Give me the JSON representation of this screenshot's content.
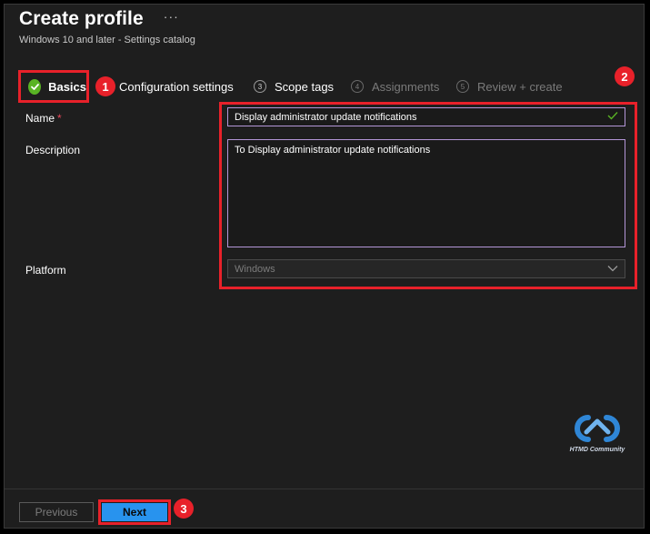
{
  "header": {
    "title": "Create profile",
    "more": "···",
    "subtitle": "Windows 10 and later - Settings catalog"
  },
  "steps": [
    {
      "num": "",
      "label": "Basics",
      "state": "complete"
    },
    {
      "num": "",
      "label": "Configuration settings",
      "state": "next"
    },
    {
      "num": "3",
      "label": "Scope tags",
      "state": "next"
    },
    {
      "num": "4",
      "label": "Assignments",
      "state": "disabled"
    },
    {
      "num": "5",
      "label": "Review + create",
      "state": "disabled"
    }
  ],
  "badges": [
    "1",
    "2",
    "3"
  ],
  "form": {
    "name_label": "Name",
    "required_mark": "*",
    "name_value": "Display administrator update notifications",
    "description_label": "Description",
    "description_value": "To Display administrator update notifications",
    "platform_label": "Platform",
    "platform_value": "Windows"
  },
  "logo": {
    "text": "HTMD Community"
  },
  "footer": {
    "previous_label": "Previous",
    "next_label": "Next"
  },
  "colors": {
    "accent": "#2893ee",
    "highlight": "#e8212a",
    "success": "#59b324"
  }
}
